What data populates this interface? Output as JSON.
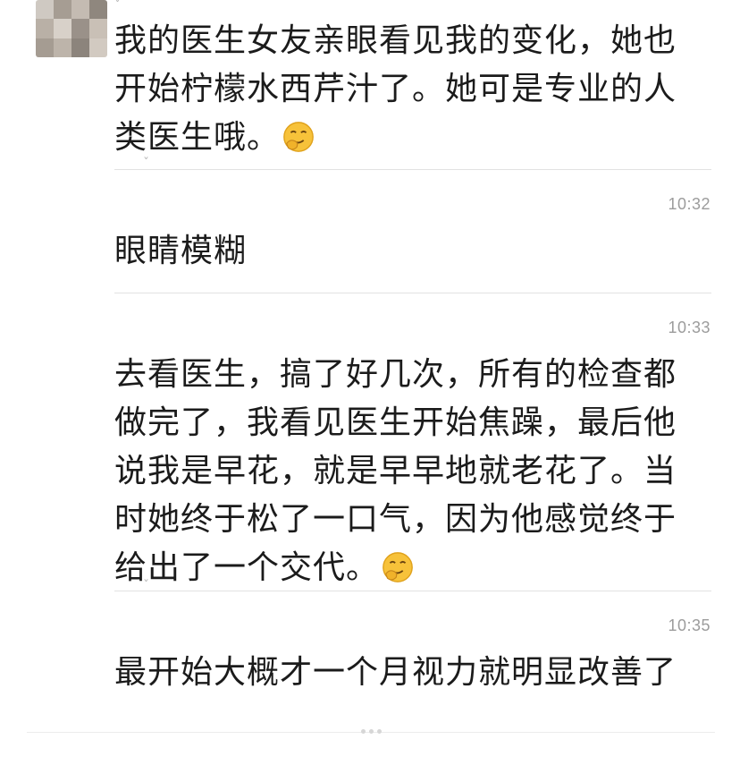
{
  "messages": [
    {
      "text": "我的医生女友亲眼看见我的变化，她也开始柠檬水西芹汁了。她可是专业的人类医生哦。",
      "emoji": "smirk-face-emoji"
    },
    {
      "timestamp": "10:32",
      "text": "眼睛模糊"
    },
    {
      "timestamp": "10:33",
      "text": "去看医生，搞了好几次，所有的检查都做完了，我看见医生开始焦躁，最后他说我是早花，就是早早地就老花了。当时她终于松了一口气，因为他感觉终于给出了一个交代。",
      "emoji": "smirk-face-emoji"
    },
    {
      "timestamp": "10:35",
      "text": "最开始大概才一个月视力就明显改善了"
    }
  ],
  "colors": {
    "text": "#1b1b1b",
    "timestamp": "#9c9c9c",
    "divider": "#e2e2e2",
    "emoji_face": "#f7c23a"
  }
}
